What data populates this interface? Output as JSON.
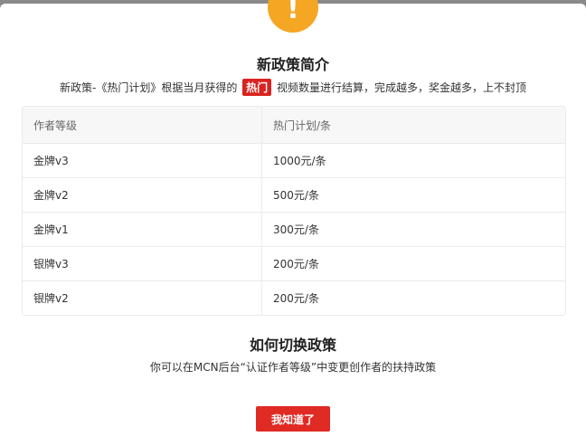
{
  "modal": {
    "icon": "exclamation-icon",
    "icon_glyph": "!",
    "icon_color": "#f5a623",
    "section1": {
      "title": "新政策简介",
      "desc_prefix": "新政策-《热门计划》根据当月获得的",
      "desc_tag": "热门",
      "desc_suffix": "视频数量进行结算，完成越多，奖金越多，上不封顶"
    },
    "table": {
      "headers": [
        "作者等级",
        "热门计划/条"
      ],
      "rows": [
        [
          "金牌v3",
          "1000元/条"
        ],
        [
          "金牌v2",
          "500元/条"
        ],
        [
          "金牌v1",
          "300元/条"
        ],
        [
          "银牌v3",
          "200元/条"
        ],
        [
          "银牌v2",
          "200元/条"
        ]
      ]
    },
    "section2": {
      "title": "如何切换政策",
      "desc": "你可以在MCN后台“认证作者等级”中变更创作者的扶持政策"
    },
    "button_label": "我知道了",
    "accent_color": "#e02a24"
  }
}
